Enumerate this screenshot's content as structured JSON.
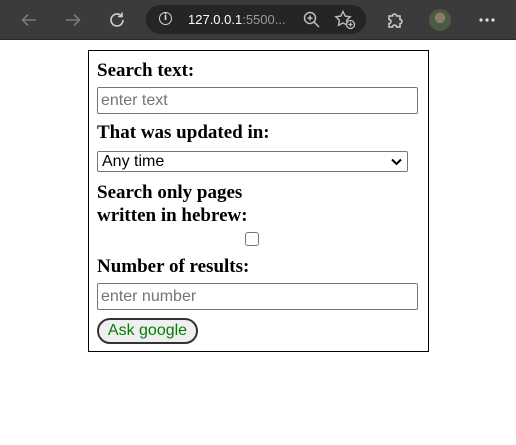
{
  "browser": {
    "url_host": "127.0.0.1",
    "url_rest": ":5500..."
  },
  "form": {
    "search_label": "Search text:",
    "search_placeholder": "enter text",
    "updated_label": "That was updated in:",
    "updated_selected": "Any time",
    "hebrew_label_line1": "Search only pages",
    "hebrew_label_line2": "written in hebrew:",
    "hebrew_checked": false,
    "results_label": "Number of results:",
    "results_placeholder": "enter number",
    "submit_label": "Ask google"
  }
}
